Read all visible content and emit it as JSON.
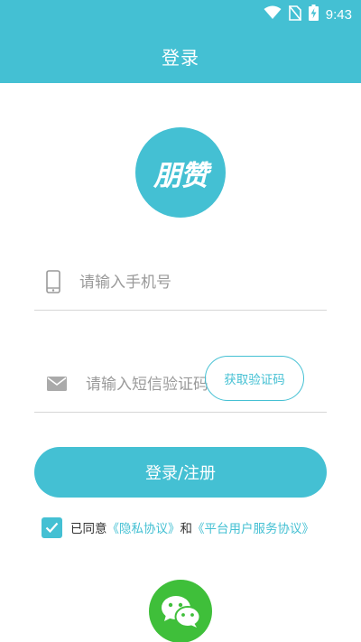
{
  "status_bar": {
    "time": "9:43"
  },
  "header": {
    "title": "登录"
  },
  "logo": {
    "text": "朋赞"
  },
  "form": {
    "phone": {
      "placeholder": "请输入手机号",
      "value": ""
    },
    "code": {
      "placeholder": "请输入短信验证码",
      "value": ""
    },
    "get_code_label": "获取验证码",
    "submit_label": "登录/注册"
  },
  "agreement": {
    "checked": true,
    "prefix": "已同意",
    "privacy_link": "《隐私协议》",
    "conjunction": "和",
    "service_link": "《平台用户服务协议》"
  },
  "theme": {
    "accent": "#44c0d3",
    "wechat": "#3fbf3a"
  }
}
